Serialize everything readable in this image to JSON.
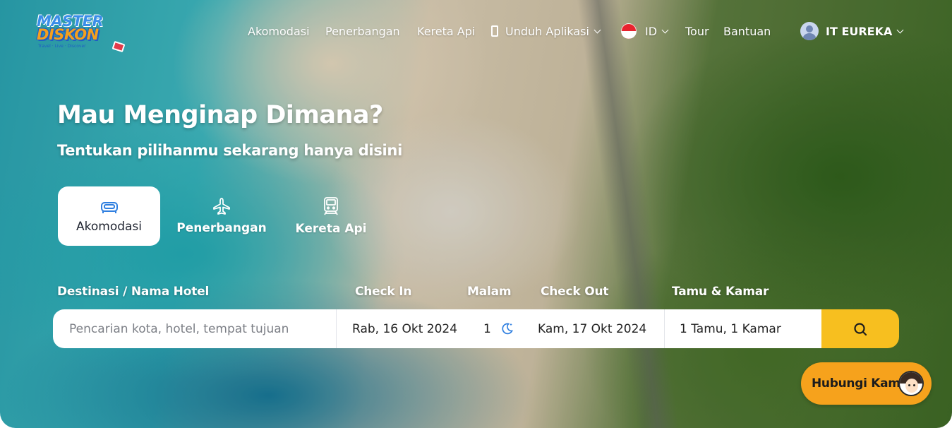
{
  "brand": {
    "name_line1": "MASTER",
    "name_line2": "DISKON",
    "tagline": "Travel · Live · Discover"
  },
  "nav": {
    "akomodasi": "Akomodasi",
    "penerbangan": "Penerbangan",
    "kereta_api": "Kereta Api",
    "unduh_aplikasi": "Unduh Aplikasi",
    "language": "ID",
    "tour": "Tour",
    "bantuan": "Bantuan",
    "user_name": "IT EUREKA"
  },
  "hero": {
    "title": "Mau Menginap Dimana?",
    "subtitle": "Tentukan pilihanmu sekarang hanya disini"
  },
  "tabs": [
    {
      "label": "Akomodasi",
      "icon": "bed-icon",
      "active": true
    },
    {
      "label": "Penerbangan",
      "icon": "airplane-icon",
      "active": false
    },
    {
      "label": "Kereta Api",
      "icon": "train-icon",
      "active": false
    }
  ],
  "search": {
    "labels": {
      "destination": "Destinasi / Nama Hotel",
      "check_in": "Check In",
      "nights": "Malam",
      "check_out": "Check Out",
      "guests": "Tamu & Kamar"
    },
    "destination_placeholder": "Pencarian kota, hotel, tempat tujuan",
    "check_in_value": "Rab, 16 Okt 2024",
    "nights_value": "1",
    "check_out_value": "Kam, 17 Okt 2024",
    "guests_value": "1 Tamu, 1 Kamar"
  },
  "contact": {
    "label": "Hubungi Kami"
  },
  "colors": {
    "accent_yellow": "#f7bf1f",
    "contact_orange": "#f6a21c",
    "moon_blue": "#2f7fe0"
  }
}
